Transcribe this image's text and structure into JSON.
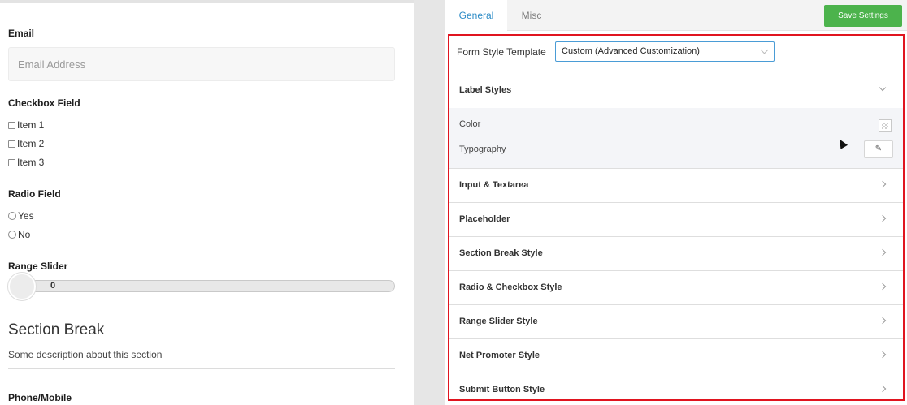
{
  "preview": {
    "email": {
      "label": "Email",
      "placeholder": "Email Address"
    },
    "checkbox": {
      "label": "Checkbox Field",
      "items": [
        "Item 1",
        "Item 2",
        "Item 3"
      ]
    },
    "radio": {
      "label": "Radio Field",
      "items": [
        "Yes",
        "No"
      ]
    },
    "range": {
      "label": "Range Slider",
      "value": "0"
    },
    "section": {
      "title": "Section Break",
      "description": "Some description about this section"
    },
    "phone": {
      "label": "Phone/Mobile"
    }
  },
  "panel": {
    "tabs": [
      {
        "label": "General",
        "active": true
      },
      {
        "label": "Misc",
        "active": false
      }
    ],
    "save_label": "Save Settings",
    "template": {
      "label": "Form Style Template",
      "selected": "Custom (Advanced Customization)"
    },
    "label_styles": {
      "title": "Label Styles",
      "color_label": "Color",
      "typography_label": "Typography"
    },
    "sections": [
      "Input & Textarea",
      "Placeholder",
      "Section Break Style",
      "Radio & Checkbox Style",
      "Range Slider Style",
      "Net Promoter Style",
      "Submit Button Style"
    ]
  },
  "colors": {
    "accent": "#2c8bc6",
    "save": "#4cb34c",
    "highlight": "#e0141f"
  }
}
